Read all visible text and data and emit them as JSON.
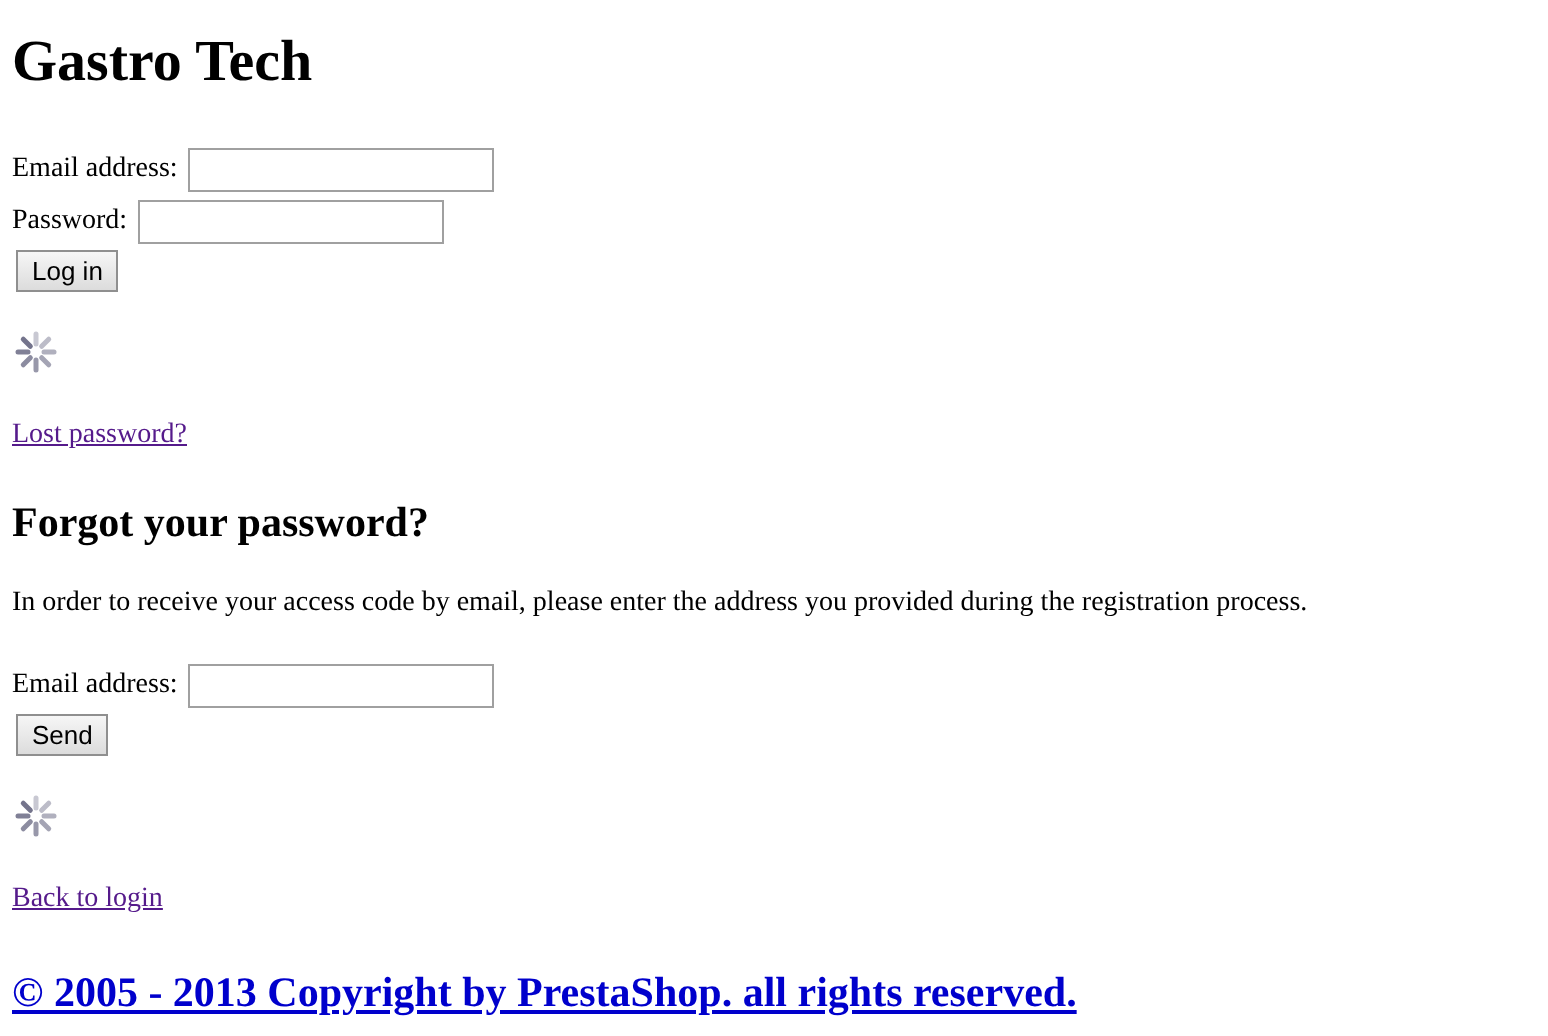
{
  "title": "Gastro Tech",
  "login": {
    "fields": [
      {
        "label": "Email address:"
      },
      {
        "label": "Password:"
      }
    ],
    "button": "Log in",
    "link": {
      "text": "Lost password?",
      "visited": true
    }
  },
  "forgot": {
    "heading": "Forgot your password?",
    "text": "In order to receive your access code by email, please enter the address you provided during the registration process.",
    "fields": [
      {
        "label": "Email address:"
      }
    ],
    "button": "Send",
    "link": {
      "text": "Back to login",
      "visited": true
    }
  },
  "footer": {
    "text": "© 2005 - 2013 Copyright by PrestaShop. all rights reserved.",
    "visited": false
  }
}
